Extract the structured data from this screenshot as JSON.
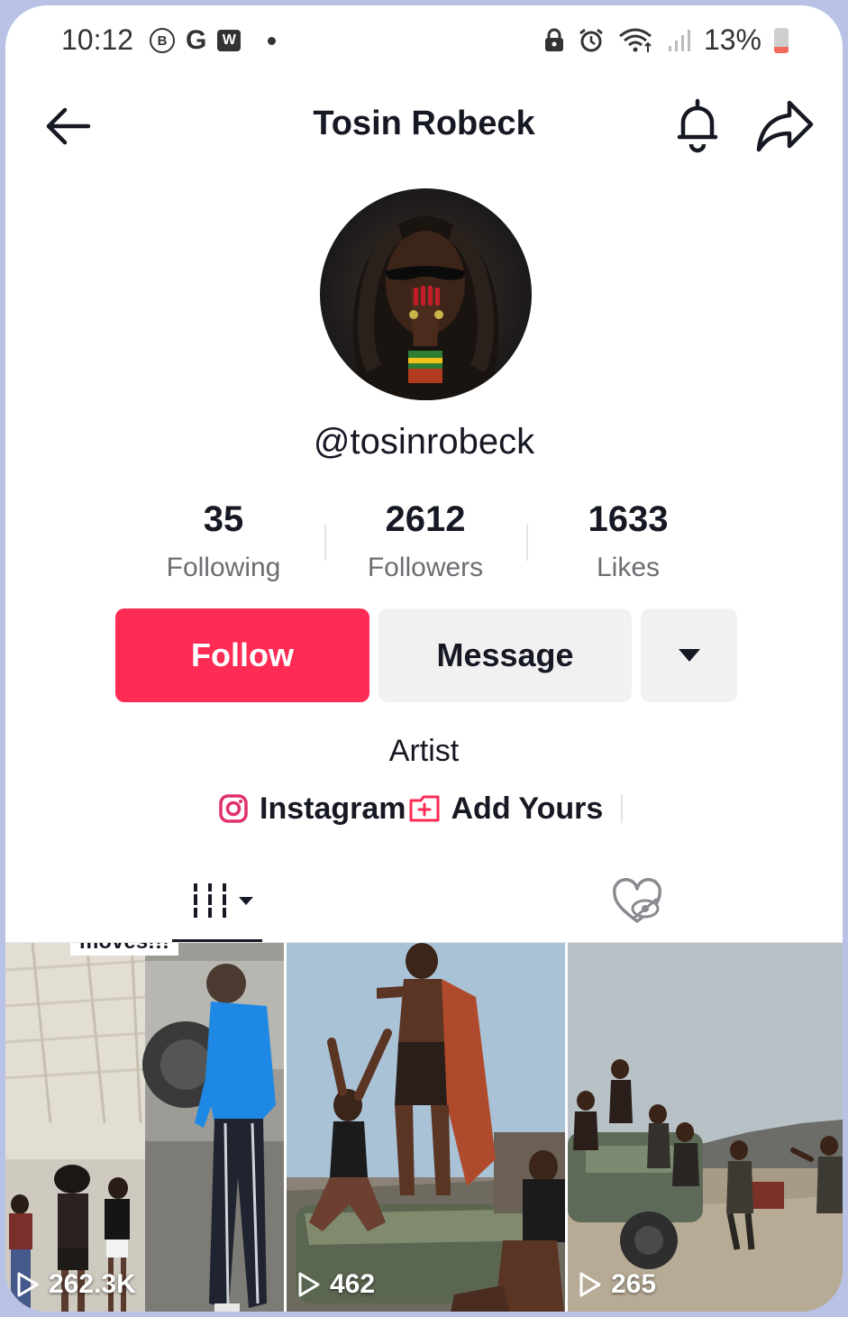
{
  "status_bar": {
    "time": "10:12",
    "icons_left": [
      "b-circle-icon",
      "google-icon",
      "w-app-icon",
      "dot-icon"
    ],
    "icon_b": "B",
    "icon_g": "G",
    "icon_w": "W",
    "icons_right": [
      "lock-icon",
      "alarm-icon",
      "wifi-icon",
      "signal-icon"
    ],
    "battery": "13%",
    "battery_level": 0.13
  },
  "header": {
    "title": "Tosin Robeck"
  },
  "profile": {
    "handle": "@tosinrobeck",
    "stats": [
      {
        "value": "35",
        "label": "Following"
      },
      {
        "value": "2612",
        "label": "Followers"
      },
      {
        "value": "1633",
        "label": "Likes"
      }
    ],
    "bio": "Artist"
  },
  "actions": {
    "follow": "Follow",
    "message": "Message"
  },
  "links": {
    "instagram": "Instagram",
    "add_yours": "Add Yours"
  },
  "videos": [
    {
      "views": "262.3K",
      "caption": "moves!!!"
    },
    {
      "views": "462"
    },
    {
      "views": "265"
    }
  ],
  "colors": {
    "follow_bg": "#fe2c55",
    "secondary_btn_bg": "#f1f1f2",
    "text_primary": "#161823",
    "text_secondary": "#6c6d72"
  }
}
